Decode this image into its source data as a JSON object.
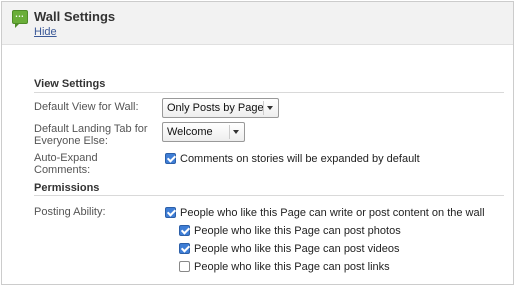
{
  "header": {
    "title": "Wall Settings",
    "hide_link": "Hide",
    "icon": "wall-app-icon",
    "accent": "#3b5998"
  },
  "view_settings": {
    "heading": "View Settings",
    "default_view": {
      "label": "Default View for Wall:",
      "value": "Only Posts by Page"
    },
    "landing_tab": {
      "label": "Default Landing Tab for Everyone Else:",
      "value": "Welcome"
    },
    "auto_expand": {
      "label": "Auto-Expand Comments:",
      "option": "Comments on stories will be expanded by default",
      "checked": true
    }
  },
  "permissions": {
    "heading": "Permissions",
    "posting_label": "Posting Ability:",
    "options": [
      {
        "label": "People who like this Page can write or post content on the wall",
        "checked": true
      },
      {
        "label": "People who like this Page can post photos",
        "checked": true
      },
      {
        "label": "People who like this Page can post videos",
        "checked": true
      },
      {
        "label": "People who like this Page can post links",
        "checked": false
      }
    ]
  }
}
